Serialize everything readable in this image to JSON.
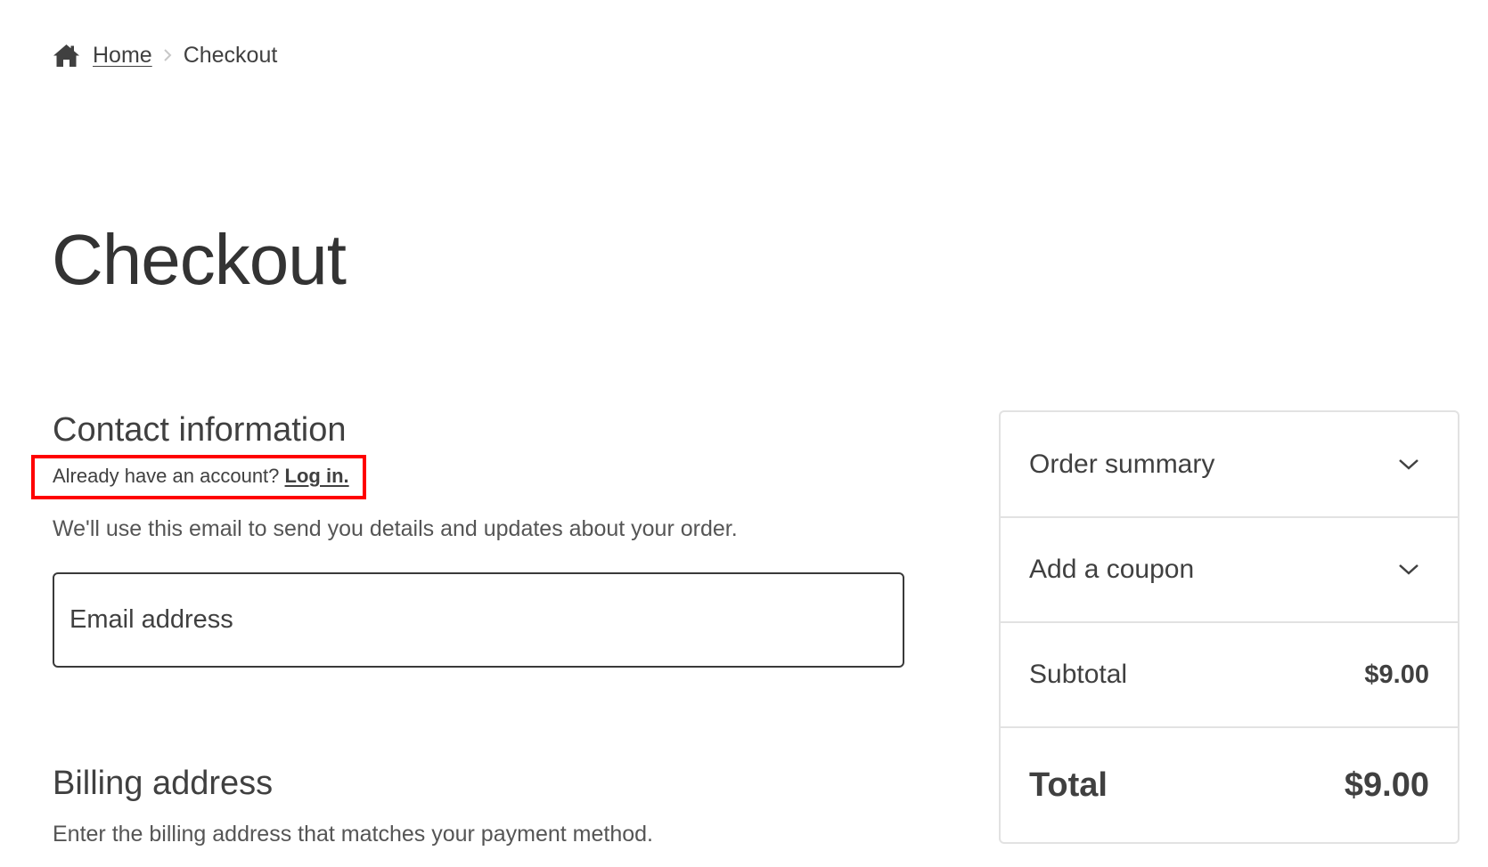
{
  "breadcrumb": {
    "home_icon": "home-icon",
    "home_label": "Home",
    "separator_icon": "chevron-right-icon",
    "current_label": "Checkout"
  },
  "page_title": "Checkout",
  "contact": {
    "heading": "Contact information",
    "account_prompt": "Already have an account?",
    "login_link": "Log in.",
    "description": "We'll use this email to send you details and updates about your order.",
    "email_placeholder": "Email address"
  },
  "billing": {
    "heading": "Billing address",
    "description": "Enter the billing address that matches your payment method."
  },
  "summary": {
    "order_summary_label": "Order summary",
    "coupon_label": "Add a coupon",
    "subtotal_label": "Subtotal",
    "subtotal_value": "$9.00",
    "total_label": "Total",
    "total_value": "$9.00",
    "expand_icon": "chevron-down-icon"
  },
  "colors": {
    "highlight_border": "#ff0000",
    "text": "#404040",
    "divider": "#e2e2e2"
  }
}
